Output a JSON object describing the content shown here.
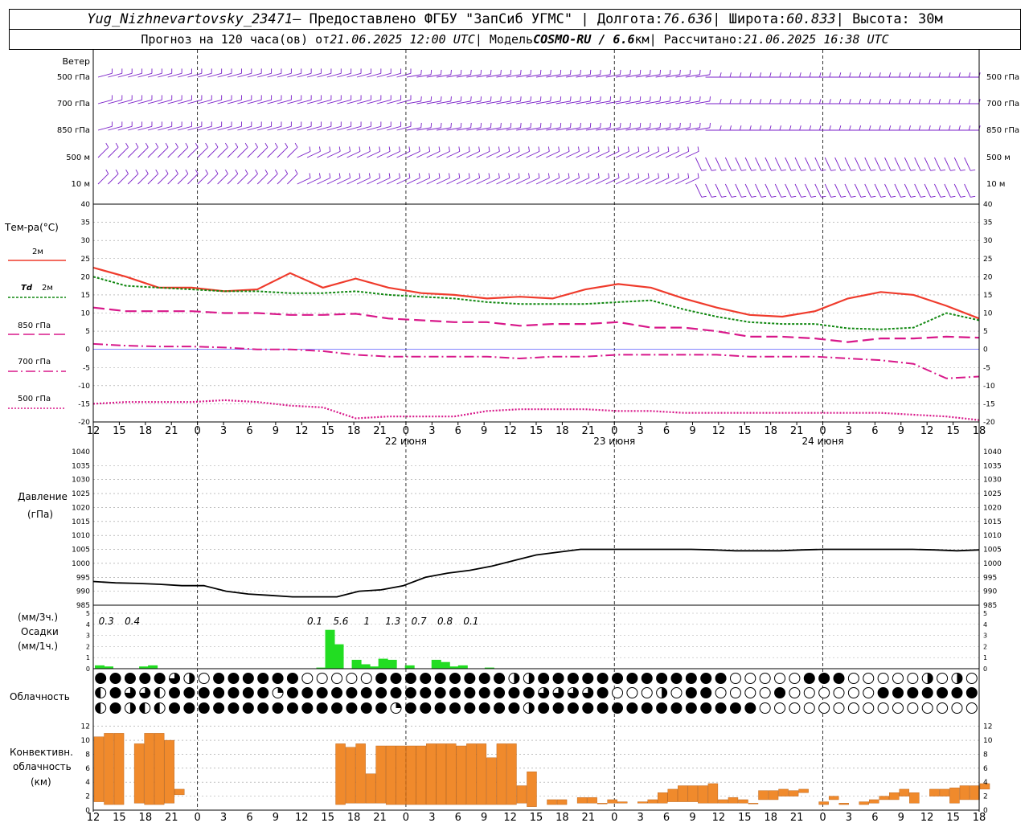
{
  "header": {
    "station": "Yug_Nizhnevartovsky_23471",
    "provider": " – Предоставлено ФГБУ \"ЗапСиб УГМС\" | Долгота: ",
    "lon": "76.636",
    "lat_label": " | Широта: ",
    "lat": "60.833",
    "alt_label": " | Высота: 30м",
    "forecast_label": "Прогноз на 120 часа(ов) от ",
    "forecast_from": "21.06.2025 12:00 UTC",
    "model_label": "  | Модель ",
    "model": "COSMO-RU / 6.6",
    "km": "км",
    "calc_label": " | Рассчитано: ",
    "calc_time": "21.06.2025 16:38 UTC"
  },
  "labels": {
    "wind": "Ветер",
    "wind_levels": [
      "500 гПа",
      "700 гПа",
      "850 гПа",
      "500 м",
      "10  м"
    ],
    "temp_title": "Тем-ра(°C)",
    "legend_2m": "2м",
    "legend_td": "Td",
    "legend_td_2m": "2м",
    "legend_850": "850 гПа",
    "legend_700": "700 гПа",
    "legend_500": "500 гПа",
    "pressure_title": "Давление",
    "pressure_unit": "(гПа)",
    "precip_unit3": "(мм/3ч.)",
    "precip_title": "Осадки",
    "precip_unit1": "(мм/1ч.)",
    "cloud_title": "Облачность",
    "conv_title1": "Конвективн.",
    "conv_title2": "облачность",
    "conv_unit": "(км)"
  },
  "colors": {
    "t2m": "#ef3b2c",
    "td2m": "#118811",
    "t850": "#d8188a",
    "t700": "#d8188a",
    "t500": "#d8188a",
    "wind": "#7a1fc8",
    "precip": "#22dd22",
    "conv": "#f08a2c",
    "pressure": "#000000"
  },
  "chart_data": [
    {
      "type": "line",
      "ylabel": "Тем-ра(°C)",
      "ylim": [
        -20,
        40
      ],
      "grid": true,
      "x": [
        0,
        3,
        6,
        9,
        12,
        15,
        18,
        21,
        24,
        27,
        30,
        33,
        36,
        39,
        42,
        45,
        48,
        51,
        54,
        57,
        60,
        63,
        66,
        69,
        72,
        75,
        78,
        81,
        84,
        87,
        90,
        93,
        96,
        99,
        102,
        105,
        108,
        111,
        114,
        117,
        120
      ],
      "x_ticks": [
        "12",
        "15",
        "18",
        "21",
        "0",
        "3",
        "6",
        "9",
        "12",
        "15",
        "18",
        "21",
        "0",
        "3",
        "6",
        "9",
        "12",
        "15",
        "18",
        "21",
        "0",
        "3",
        "6",
        "9",
        "12",
        "15",
        "18",
        "21",
        "0",
        "3",
        "6",
        "9",
        "12",
        "15",
        "18"
      ],
      "date_labels": [
        {
          "at": 36,
          "text": "22 июня"
        },
        {
          "at": 60,
          "text": "23 июня"
        },
        {
          "at": 84,
          "text": "24 июня"
        }
      ],
      "series": [
        {
          "name": "2м",
          "values": [
            22.5,
            20,
            17,
            17,
            16,
            16.5,
            21,
            17,
            19.5,
            17,
            15.5,
            15,
            14,
            14.5,
            14,
            16.5,
            18,
            17,
            14,
            11.5,
            9.5,
            9,
            10.5,
            14,
            15.8,
            15,
            12,
            8.5
          ]
        },
        {
          "name": "Td 2м",
          "values": [
            20,
            17.5,
            17,
            16.5,
            16,
            16,
            15.5,
            15.5,
            16,
            15,
            14.5,
            14,
            13,
            12.5,
            12.5,
            12.5,
            13,
            13.5,
            11,
            9,
            7.5,
            7,
            7,
            5.8,
            5.5,
            6,
            10,
            8
          ]
        },
        {
          "name": "850 гПа",
          "values": [
            11.5,
            10.5,
            10.5,
            10.5,
            10,
            10,
            9.5,
            9.5,
            9.8,
            8.5,
            8,
            7.5,
            7.5,
            6.5,
            7,
            7,
            7.5,
            6,
            6,
            5,
            3.5,
            3.5,
            3,
            2,
            3,
            3,
            3.5,
            3.2
          ]
        },
        {
          "name": "700 гПа",
          "values": [
            1.5,
            1,
            0.8,
            0.8,
            0.5,
            0,
            0,
            -0.5,
            -1.5,
            -2,
            -2,
            -2,
            -2,
            -2.5,
            -2,
            -2,
            -1.5,
            -1.5,
            -1.5,
            -1.5,
            -2,
            -2,
            -2,
            -2.5,
            -3,
            -4,
            -8,
            -7.5
          ]
        },
        {
          "name": "500 гПа",
          "values": [
            -15,
            -14.5,
            -14.5,
            -14.5,
            -14,
            -14.5,
            -15.5,
            -16,
            -19,
            -18.5,
            -18.5,
            -18.5,
            -17,
            -16.5,
            -16.5,
            -16.5,
            -17,
            -17,
            -17.5,
            -17.5,
            -17.5,
            -17.5,
            -17.5,
            -17.5,
            -17.5,
            -18,
            -18.5,
            -19.5
          ]
        }
      ]
    },
    {
      "type": "line",
      "ylabel": "Давление (гПа)",
      "ylim": [
        985,
        1040
      ],
      "grid": true,
      "x": [
        0,
        3,
        6,
        9,
        12,
        15,
        18,
        21,
        24,
        27,
        30,
        33,
        36,
        39,
        42,
        45,
        48,
        51,
        54,
        57,
        60,
        63,
        66,
        69,
        72,
        75,
        78,
        81,
        84,
        87,
        90,
        93,
        96,
        99,
        102,
        105,
        108,
        111,
        114,
        117,
        120
      ],
      "series": [
        {
          "name": "",
          "values": [
            993.5,
            993,
            992.8,
            992.5,
            992,
            992,
            990,
            989,
            988.5,
            988,
            988,
            988,
            990,
            990.5,
            992,
            995,
            996.5,
            997.5,
            999,
            1001,
            1003,
            1004,
            1005,
            1005,
            1005,
            1005,
            1005,
            1005,
            1004.8,
            1004.5,
            1004.5,
            1004.5,
            1004.8,
            1005,
            1005,
            1005,
            1005,
            1005,
            1004.8,
            1004.5,
            1004.8
          ]
        }
      ]
    },
    {
      "type": "bar",
      "ylabel": "Осадки (мм/1ч.)",
      "ylim": [
        0,
        5
      ],
      "values": [
        0.3,
        0.2,
        0,
        0,
        0,
        0.2,
        0.3,
        0,
        0,
        0,
        0,
        0,
        0,
        0,
        0,
        0,
        0,
        0,
        0,
        0,
        0,
        0,
        0,
        0,
        0,
        0.1,
        3.5,
        2.2,
        0,
        0.8,
        0.4,
        0.2,
        0.9,
        0.8,
        0,
        0.3,
        0,
        0,
        0.8,
        0.6,
        0.2,
        0.3,
        0,
        0,
        0.1
      ],
      "annotations_3h": [
        {
          "at": 1.5,
          "text": "0.3"
        },
        {
          "at": 4.5,
          "text": "0.4"
        },
        {
          "at": 25.5,
          "text": "0.1"
        },
        {
          "at": 28.5,
          "text": "5.6"
        },
        {
          "at": 31.5,
          "text": "1"
        },
        {
          "at": 34.5,
          "text": "1.3"
        },
        {
          "at": 37.5,
          "text": "0.7"
        },
        {
          "at": 40.5,
          "text": "0.8"
        },
        {
          "at": 43.5,
          "text": "0.1"
        }
      ]
    },
    {
      "type": "bar",
      "ylabel": "Конвективн. облачность (км)",
      "ylim": [
        0,
        13
      ],
      "segments": [
        [
          0,
          1.2,
          10.5
        ],
        [
          1,
          0.8,
          11
        ],
        [
          2,
          0.8,
          11
        ],
        [
          4,
          1,
          9.5
        ],
        [
          5,
          0.8,
          11
        ],
        [
          6,
          0.8,
          11
        ],
        [
          7,
          1,
          10
        ],
        [
          8,
          2.2,
          3
        ],
        [
          24,
          0.8,
          9.5
        ],
        [
          25,
          1,
          9
        ],
        [
          26,
          1,
          9.5
        ],
        [
          27,
          1,
          5.2
        ],
        [
          28,
          1,
          9.2
        ],
        [
          29,
          0.8,
          9.2
        ],
        [
          30,
          0.8,
          9.2
        ],
        [
          31,
          0.8,
          9.2
        ],
        [
          32,
          0.8,
          9.2
        ],
        [
          33,
          0.8,
          9.5
        ],
        [
          34,
          0.8,
          9.5
        ],
        [
          35,
          0.8,
          9.5
        ],
        [
          36,
          0.8,
          9.2
        ],
        [
          37,
          0.8,
          9.5
        ],
        [
          38,
          0.8,
          9.5
        ],
        [
          39,
          0.8,
          7.5
        ],
        [
          40,
          0.8,
          9.5
        ],
        [
          41,
          0.8,
          9.5
        ],
        [
          42,
          1,
          3.5
        ],
        [
          43,
          0.5,
          5.5
        ],
        [
          45,
          0.8,
          1.5
        ],
        [
          46,
          0.8,
          1.5
        ],
        [
          48,
          1,
          1.8
        ],
        [
          49,
          1,
          1.8
        ],
        [
          50,
          1,
          1
        ],
        [
          51,
          1,
          1.5
        ],
        [
          52,
          1,
          1.2
        ],
        [
          54,
          1,
          1.2
        ],
        [
          55,
          1,
          1.5
        ],
        [
          56,
          1,
          2.5
        ],
        [
          57,
          1.2,
          3
        ],
        [
          58,
          1.2,
          3.5
        ],
        [
          59,
          1.2,
          3.5
        ],
        [
          60,
          1,
          3.5
        ],
        [
          61,
          1,
          3.8
        ],
        [
          62,
          1,
          1.5
        ],
        [
          63,
          1,
          1.8
        ],
        [
          64,
          1,
          1.5
        ],
        [
          65,
          1,
          1
        ],
        [
          66,
          1.5,
          2.8
        ],
        [
          67,
          1.5,
          2.8
        ],
        [
          68,
          2,
          3
        ],
        [
          69,
          2,
          2.8
        ],
        [
          70,
          2.5,
          3
        ],
        [
          72,
          0.8,
          1.2
        ],
        [
          73,
          1.5,
          2
        ],
        [
          74,
          0.8,
          1
        ],
        [
          76,
          0.8,
          1.2
        ],
        [
          77,
          1,
          1.5
        ],
        [
          78,
          1.5,
          2
        ],
        [
          79,
          1.5,
          2.5
        ],
        [
          80,
          2,
          3
        ],
        [
          81,
          1,
          2.5
        ],
        [
          83,
          2,
          3
        ],
        [
          84,
          2,
          3
        ],
        [
          85,
          1,
          3.2
        ],
        [
          86,
          1.5,
          3.5
        ],
        [
          87,
          1.5,
          3.5
        ],
        [
          88,
          3,
          3.8
        ]
      ]
    }
  ]
}
